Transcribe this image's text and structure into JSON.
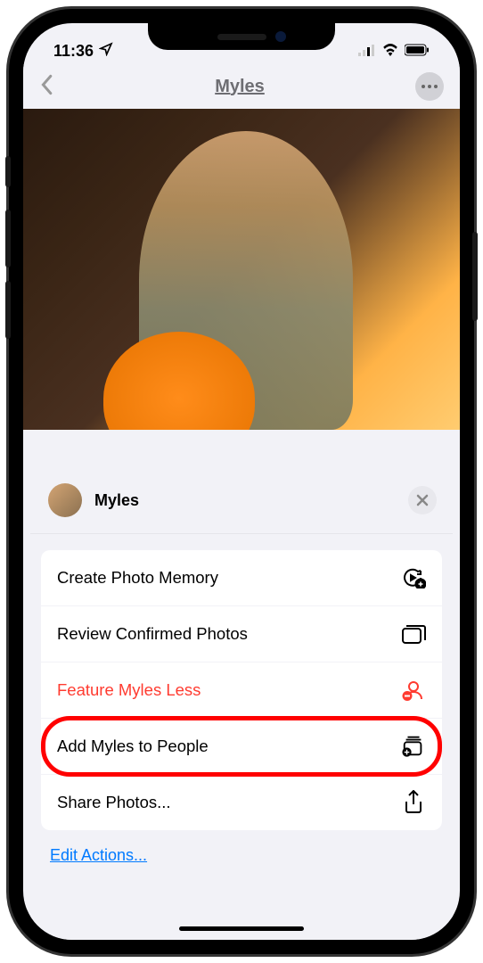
{
  "status": {
    "time": "11:36",
    "location_icon": "location-arrow"
  },
  "nav": {
    "title": "Myles"
  },
  "sheet": {
    "name": "Myles",
    "actions": [
      {
        "label": "Create Photo Memory",
        "icon": "memory-play",
        "danger": false,
        "highlight": false
      },
      {
        "label": "Review Confirmed Photos",
        "icon": "photo-stack",
        "danger": false,
        "highlight": false
      },
      {
        "label": "Feature Myles Less",
        "icon": "person-minus",
        "danger": true,
        "highlight": false
      },
      {
        "label": "Add Myles to People",
        "icon": "add-to-collection",
        "danger": false,
        "highlight": true
      },
      {
        "label": "Share Photos...",
        "icon": "share",
        "danger": false,
        "highlight": false
      }
    ],
    "edit_label": "Edit Actions..."
  }
}
